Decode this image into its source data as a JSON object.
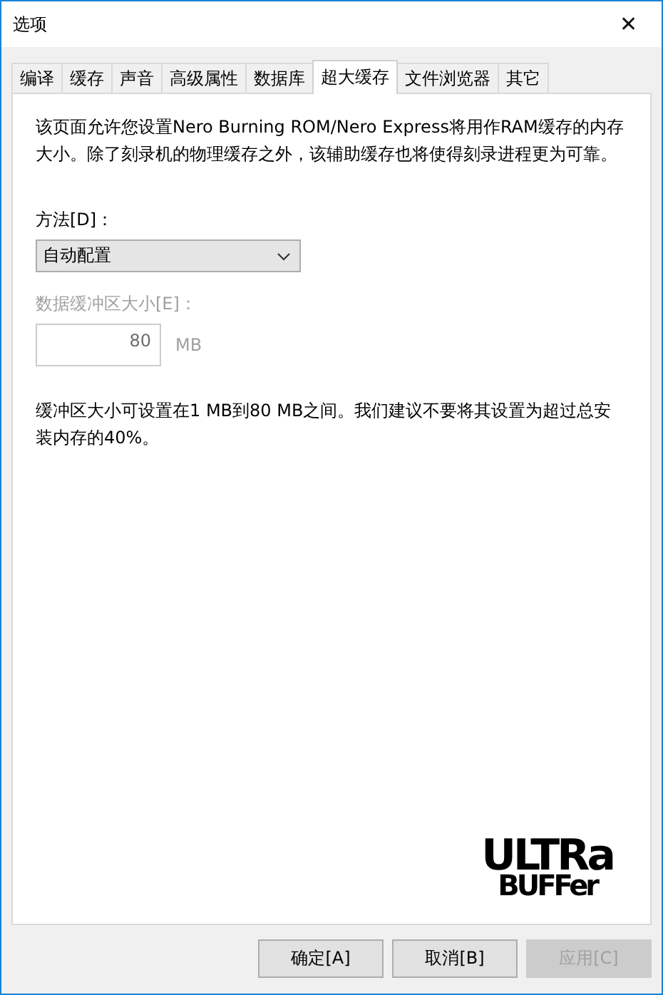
{
  "window": {
    "title": "选项",
    "close": "✕"
  },
  "tabs": [
    {
      "label": "编译",
      "selected": false
    },
    {
      "label": "缓存",
      "selected": false
    },
    {
      "label": "声音",
      "selected": false
    },
    {
      "label": "高级属性",
      "selected": false
    },
    {
      "label": "数据库",
      "selected": false
    },
    {
      "label": "超大缓存",
      "selected": true
    },
    {
      "label": "文件浏览器",
      "selected": false
    },
    {
      "label": "其它",
      "selected": false
    }
  ],
  "description": "该页面允许您设置Nero Burning ROM/Nero Express将用作RAM缓存的内存大小。除了刻录机的物理缓存之外，该辅助缓存也将使得刻录进程更为可靠。",
  "method": {
    "label": "方法[D]：",
    "value": "自动配置"
  },
  "buffer_size": {
    "label": "数据缓冲区大小[E]：",
    "value": "80",
    "unit": "MB",
    "disabled": true
  },
  "note": "缓冲区大小可设置在1 MB到80 MB之间。我们建议不要将其设置为超过总安装内存的40%。",
  "logo": {
    "line1": "ULTRa",
    "line2": "BUFFer"
  },
  "buttons": [
    {
      "label": "确定[A]",
      "disabled": false
    },
    {
      "label": "取消[B]",
      "disabled": false
    },
    {
      "label": "应用[C]",
      "disabled": true
    }
  ]
}
